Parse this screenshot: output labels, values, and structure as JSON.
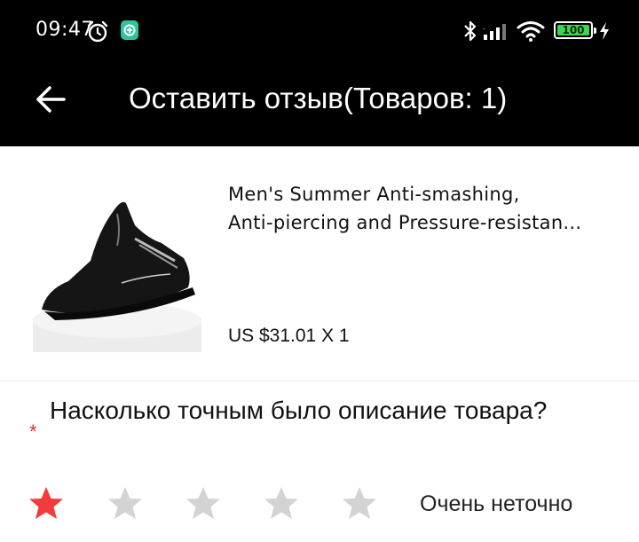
{
  "status_bar": {
    "time": "09:47",
    "battery": "100",
    "icons": [
      "alarm-icon",
      "vpn-shield-icon",
      "bluetooth-icon",
      "signal-icon",
      "wifi-icon",
      "battery-icon",
      "charging-icon"
    ]
  },
  "header": {
    "title": "Оставить отзыв(Товаров: 1)",
    "back_icon": "arrow-left-icon"
  },
  "product": {
    "name_line1": "Men's Summer Anti-smashing,",
    "name_line2": "Anti-piercing and Pressure-resistan...",
    "price": "US $31.01 X 1",
    "image": "black-mesh-safety-sneaker"
  },
  "question": {
    "text": "Насколько точным было описание товара?",
    "required_mark": "*"
  },
  "rating": {
    "value": 1,
    "max": 5,
    "label": "Очень неточно",
    "active_color": "#f23b3b",
    "inactive_color": "#d3d3d3"
  },
  "colors": {
    "header_bg": "#000000",
    "battery_green": "#3ed64f"
  }
}
